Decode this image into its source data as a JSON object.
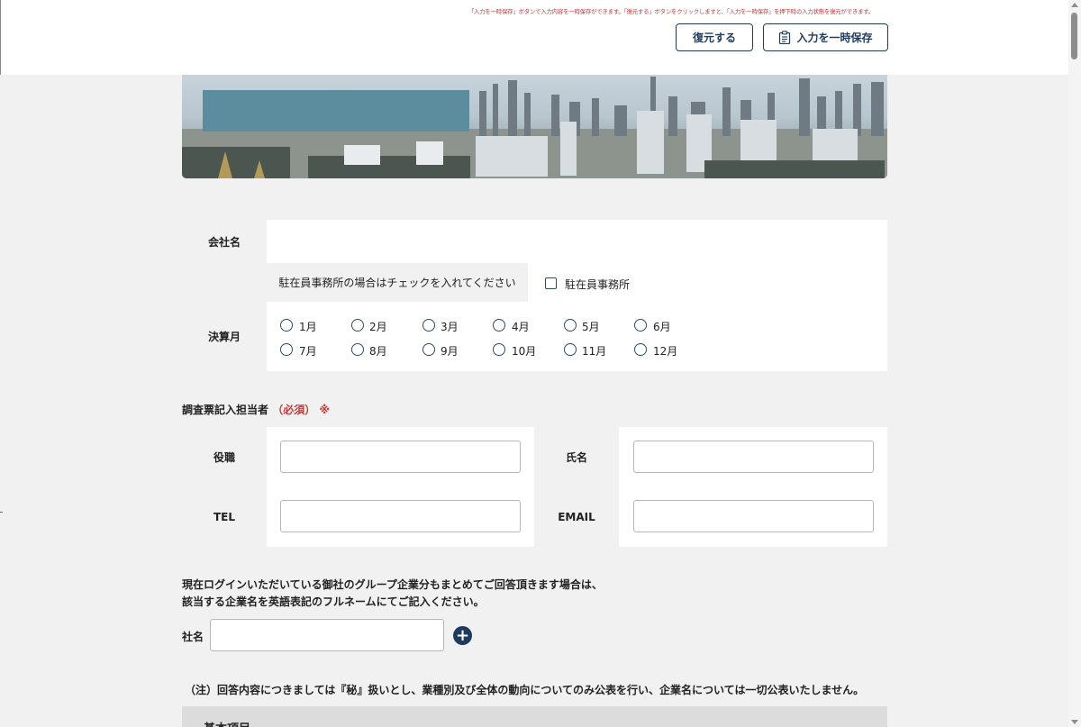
{
  "header": {
    "note": "「入力を一時保存」ボタンで入力内容を一時保存ができます。「復元する」ボタンをクリックしますと、「入力を一時保存」を押下時の入力状態を復元ができます。",
    "restore_label": "復元する",
    "save_label": "入力を一時保存"
  },
  "company": {
    "name_label": "会社名",
    "name_value": "",
    "rep_office_prompt": "駐在員事務所の場合はチェックを入れてください",
    "rep_office_checkbox_label": "駐在員事務所",
    "rep_office_checked": false,
    "fiscal_month_label": "決算月",
    "months": [
      "1月",
      "2月",
      "3月",
      "4月",
      "5月",
      "6月",
      "7月",
      "8月",
      "9月",
      "10月",
      "11月",
      "12月"
    ],
    "selected_month": null
  },
  "contact": {
    "title": "調査票記入担当者",
    "required": "（必須）",
    "mark": "※",
    "position_label": "役職",
    "name_label": "氏名",
    "tel_label": "TEL",
    "email_label": "EMAIL",
    "position_value": "",
    "name_value": "",
    "tel_value": "",
    "email_value": ""
  },
  "group": {
    "line1": "現在ログインいただいている御社のグループ企業分もまとめてご回答頂きます場合は、",
    "line2": "該当する企業名を英語表記のフルネームにてご記入ください。",
    "company_label": "社名",
    "company_value": "",
    "add_symbol": "+"
  },
  "disclaimer": "（注）回答内容につきましては『秘』扱いとし、業種別及び全体の動向についてのみ公表を行い、企業名については一切公表いたしません。",
  "basic_section_title": "基本項目"
}
